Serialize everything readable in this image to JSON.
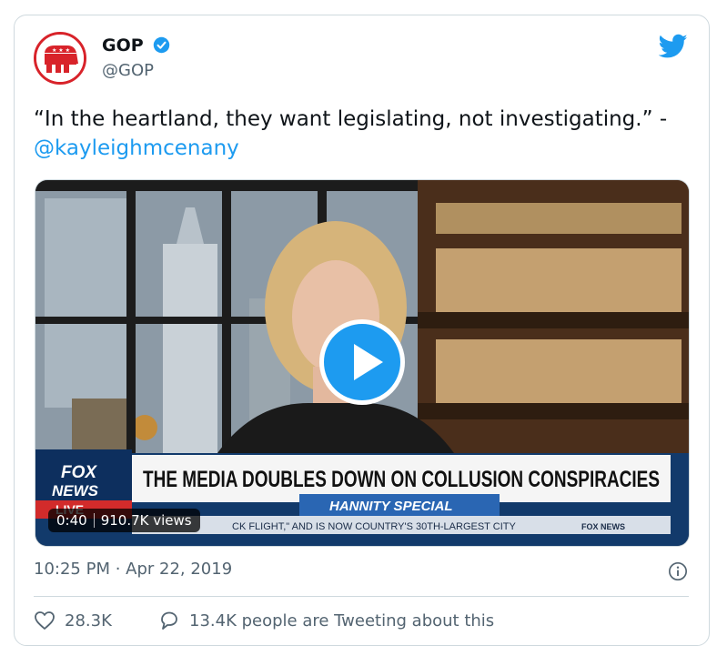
{
  "author": {
    "name": "GOP",
    "handle": "@GOP"
  },
  "tweet": {
    "text": "“In the heartland, they want legislating, not investigating.” -",
    "mention": "@kayleighmcenany"
  },
  "media": {
    "chyron_headline": "THE MEDIA DOUBLES DOWN ON COLLUSION CONSPIRACIES",
    "chyron_show": "HANNITY SPECIAL",
    "chyron_ticker": "CK FLIGHT,\" AND IS NOW COUNTRY'S 30TH-LARGEST CITY",
    "network_logo_top": "FOX",
    "network_logo_bottom": "NEWS",
    "network_live": "LIVE",
    "ticker_logo": "FOX NEWS",
    "duration": "0:40",
    "views": "910.7K views"
  },
  "timestamp": "10:25 PM · Apr 22, 2019",
  "actions": {
    "likes": "28.3K",
    "replies": "13.4K people are Tweeting about this"
  },
  "colors": {
    "accent": "#1d9bf0",
    "gop_red": "#d8232a",
    "muted": "#536471",
    "border": "#cfd9de"
  },
  "icons": [
    "gop-elephant-icon",
    "verified-badge-icon",
    "twitter-bird-icon",
    "play-icon",
    "info-icon",
    "heart-icon",
    "reply-bubble-icon"
  ]
}
